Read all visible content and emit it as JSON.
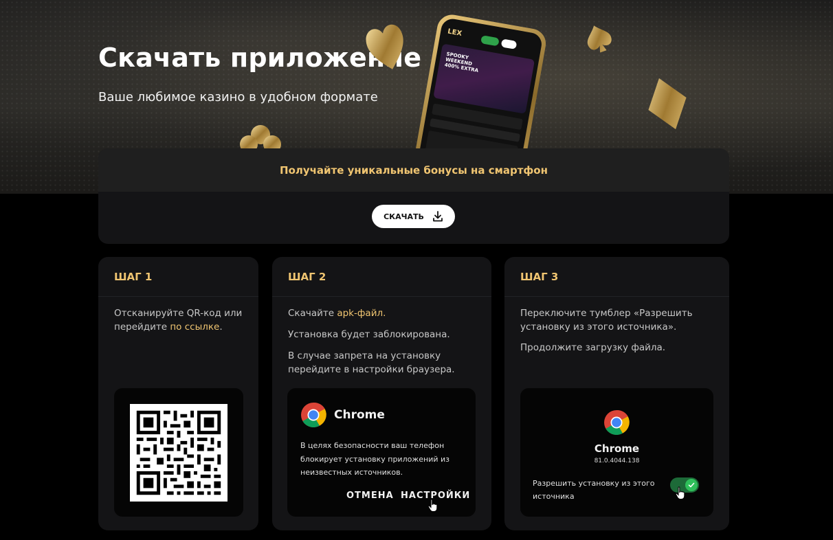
{
  "hero": {
    "title": "Скачать приложение",
    "subtitle": "Ваше любимое казино в удобном формате",
    "phone": {
      "logo": "LEX",
      "banner_text": "SPOOKY WEEKEND 400% EXTRA"
    }
  },
  "promo": {
    "bonus_text": "Получайте уникальные бонусы на смартфон",
    "download_label": "СКАЧАТЬ"
  },
  "steps": [
    {
      "title": "ШАГ 1",
      "text_before": "Отсканируйте QR-код или перейдите ",
      "link": "по ссылке",
      "text_after": "."
    },
    {
      "title": "ШАГ 2",
      "text_before": "Скачайте ",
      "link": "apk-файл",
      "text_after": ".",
      "para2": "Установка будет заблокирована.",
      "para3": "В случае запрета на установку перейдите в настройки браузера.",
      "dialog": {
        "app_name": "Chrome",
        "message": "В целях безопасности ваш телефон блокирует установку приложений из неизвестных источников.",
        "cancel": "ОТМЕНА",
        "settings": "НАСТРОЙКИ"
      }
    },
    {
      "title": "ШАГ 3",
      "para1": "Переключите тумблер «Разрешить установку из этого источника».",
      "para2": "Продолжите загрузку файла.",
      "card": {
        "app_name": "Chrome",
        "version": "81.0.4044.138",
        "toggle_label": "Разрешить установку из этого источника",
        "toggle_on": true
      }
    }
  ],
  "colors": {
    "accent": "#f0c571",
    "panel": "#141416",
    "toggle": "#2fbf5a"
  }
}
